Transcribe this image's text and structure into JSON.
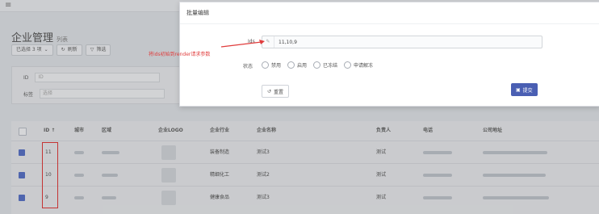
{
  "page": {
    "title": "企业管理",
    "subtitle": "列表",
    "toolbar": {
      "selected_label": "已选择 3 项",
      "refresh_label": "刷新",
      "filter_label": "筛选"
    },
    "filter": {
      "id_label": "ID",
      "id_placeholder": "ID",
      "tag_label": "标签",
      "tag_placeholder": "选择"
    },
    "table": {
      "headers": [
        "ID",
        "城市",
        "区域",
        "企业LOGO",
        "企业行业",
        "企业名称",
        "负责人",
        "电话",
        "公司地址"
      ],
      "rows": [
        {
          "id": "11",
          "industry": "装备制造",
          "name": "测试3",
          "owner": "测试"
        },
        {
          "id": "10",
          "industry": "精细化工",
          "name": "测试2",
          "owner": "测试"
        },
        {
          "id": "9",
          "industry": "健康食品",
          "name": "测试3",
          "owner": "测试"
        }
      ]
    }
  },
  "modal": {
    "title": "批量编辑",
    "ids_label": "Ids",
    "ids_value": "11,10,9",
    "status_label": "状态",
    "status_options": [
      "禁用",
      "启用",
      "已冻结",
      "申请解冻"
    ],
    "reset_label": "重置",
    "submit_label": "提交"
  },
  "annotation": {
    "text": "将ids初始到render请求参数",
    "color": "#e03c3c"
  },
  "colors": {
    "primary": "#4a5fb3",
    "checkbox_checked": "#5b74c6",
    "highlight": "#e03c3c"
  }
}
